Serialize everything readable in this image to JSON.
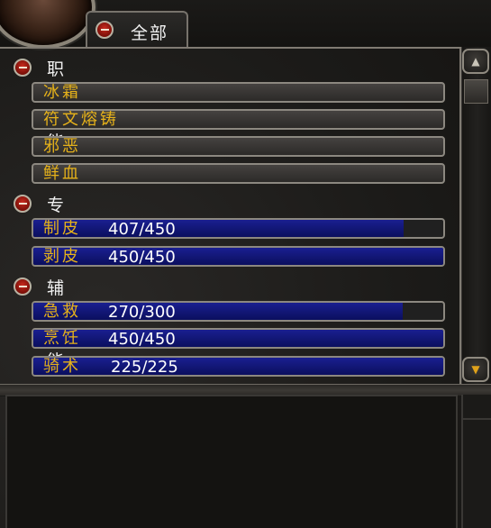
{
  "tab": {
    "label": "全部"
  },
  "sections": [
    {
      "title": "职业技能",
      "items": [
        {
          "name": "冰霜"
        },
        {
          "name": "符文熔铸"
        },
        {
          "name": "邪恶"
        },
        {
          "name": "鲜血"
        }
      ]
    },
    {
      "title": "专业",
      "items": [
        {
          "name": "制皮",
          "value": "407/450",
          "progress": 0.904
        },
        {
          "name": "剥皮",
          "value": "450/450",
          "progress": 1.0
        }
      ]
    },
    {
      "title": "辅助技能",
      "items": [
        {
          "name": "急救",
          "value": "270/300",
          "progress": 0.9
        },
        {
          "name": "烹饪",
          "value": "450/450",
          "progress": 1.0
        },
        {
          "name": "骑术",
          "value": "225/225",
          "progress": 1.0
        }
      ]
    }
  ],
  "icons": {
    "scroll_up": "chevron-up-icon",
    "tracking": "tracking-eye-icon"
  }
}
